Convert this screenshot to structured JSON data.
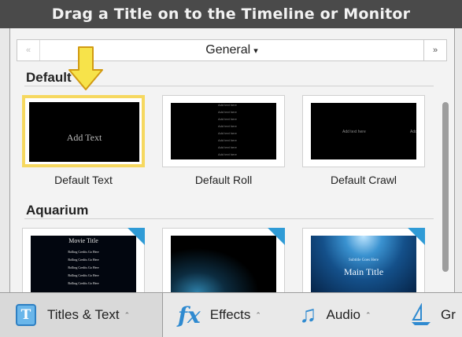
{
  "header": {
    "title": "Drag a Title on to the Timeline or Monitor"
  },
  "nav": {
    "prev_icon": "«",
    "next_icon": "»",
    "category": "General",
    "caret": "▾"
  },
  "sections": {
    "default": {
      "title": "Default"
    },
    "aquarium": {
      "title": "Aquarium"
    }
  },
  "thumbs": {
    "default_text": {
      "label": "Default Text",
      "preview_text": "Add Text"
    },
    "default_roll": {
      "label": "Default Roll",
      "preview_text": "Add text here"
    },
    "default_crawl": {
      "label": "Default Crawl",
      "preview_text": "Add text here"
    },
    "aq1": {
      "title": "Movie Title",
      "credit": "Rolling Credits Go Here"
    },
    "aq3": {
      "subtitle": "Subtitle Goes Here",
      "title": "Main Title"
    }
  },
  "tabs": [
    {
      "label": "Titles & Text",
      "icon": "T",
      "chevron": "⌃"
    },
    {
      "label": "Effects",
      "icon": "fx",
      "chevron": "⌃"
    },
    {
      "label": "Audio",
      "icon": "♫",
      "chevron": "⌃"
    },
    {
      "label": "Gr"
    }
  ],
  "colors": {
    "header_bg": "#4a4a4a",
    "selection": "#f6d85f",
    "arrow": "#f7e34a",
    "accent": "#2f9bd6"
  }
}
